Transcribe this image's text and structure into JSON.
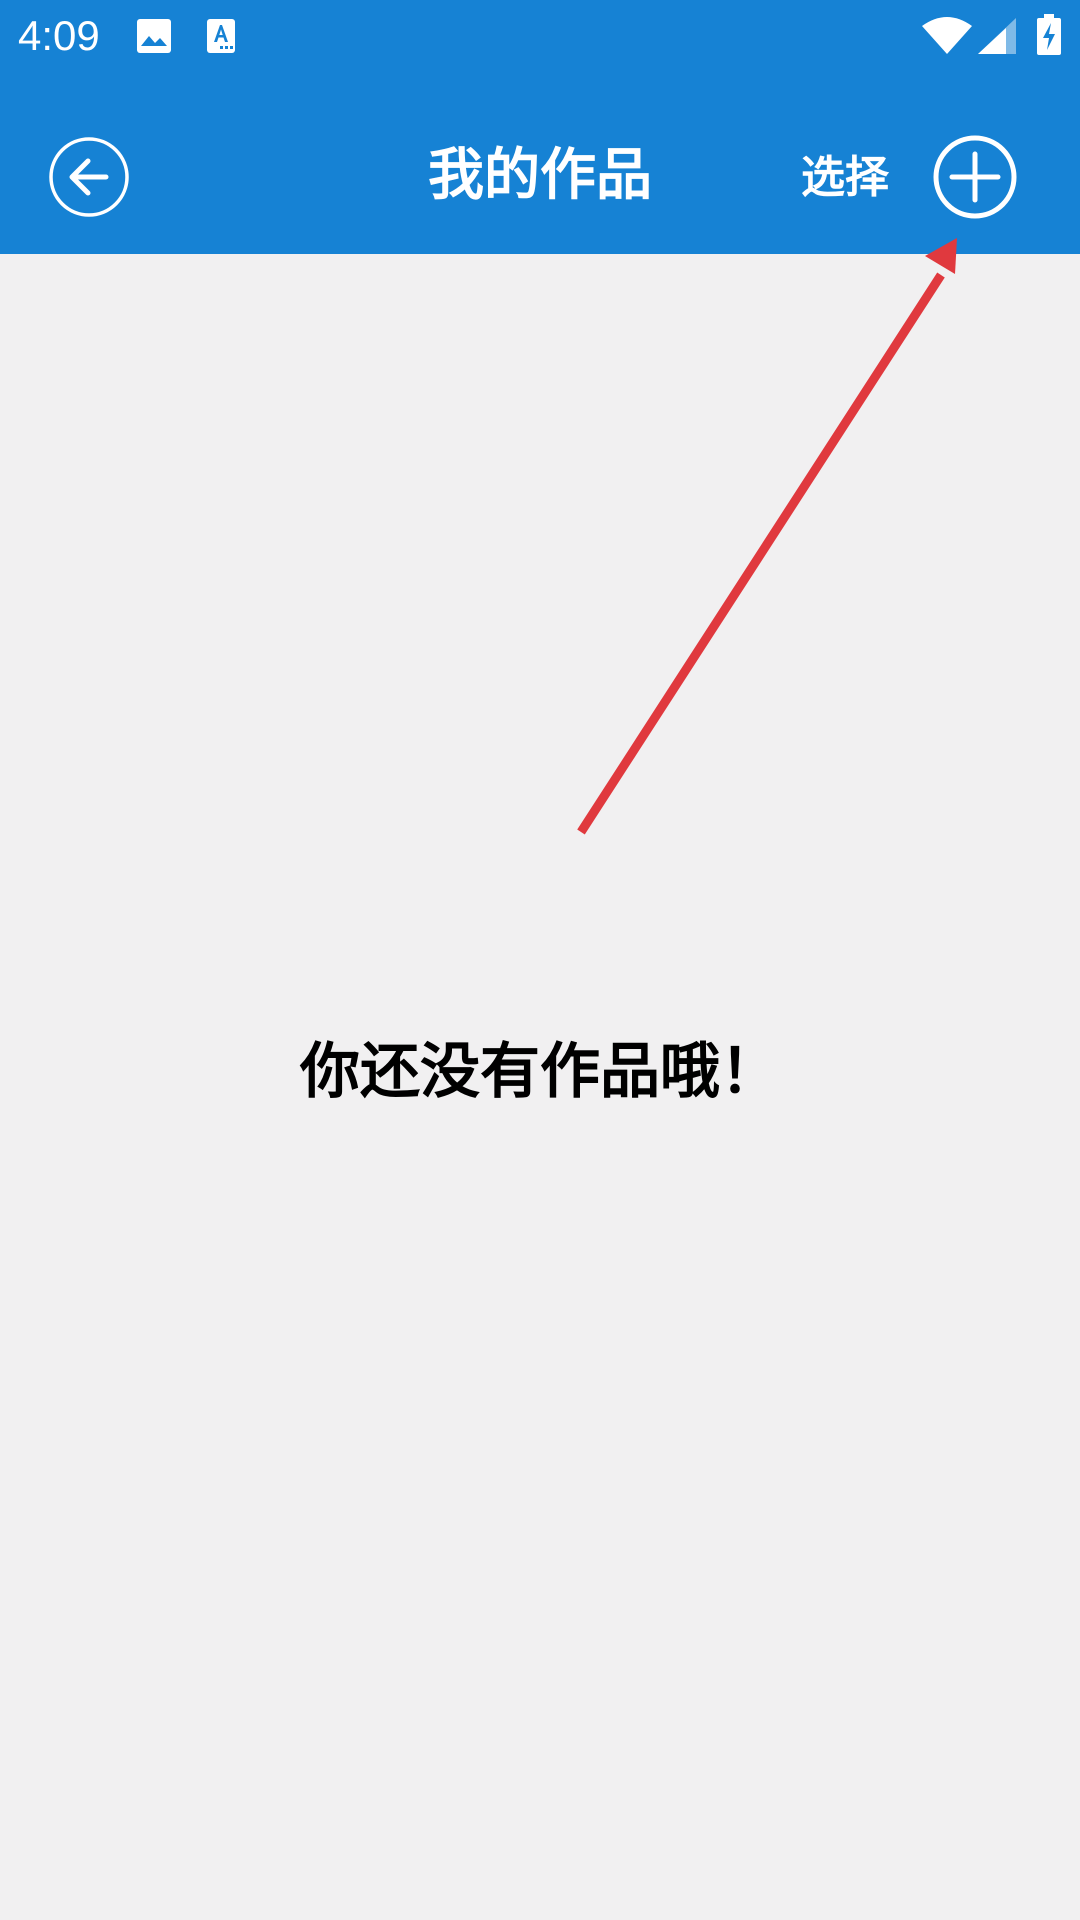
{
  "status_bar": {
    "time": "4:09",
    "icons": [
      "image-icon",
      "text-recognition-icon",
      "wifi-icon",
      "cellular-signal-icon",
      "battery-charging-icon"
    ]
  },
  "toolbar": {
    "title": "我的作品",
    "select_label": "选择",
    "back_icon": "back-arrow-icon",
    "add_icon": "plus-icon"
  },
  "main": {
    "empty_message": "你还没有作品哦！"
  },
  "colors": {
    "header_background": "#1682d4",
    "page_background": "#f1f0f1",
    "annotation_arrow": "#e0393e"
  }
}
